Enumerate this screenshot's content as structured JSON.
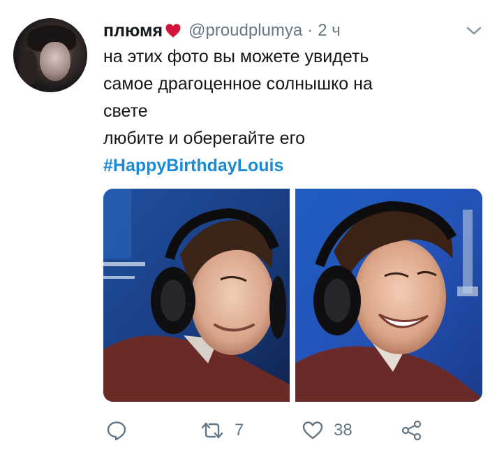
{
  "tweet": {
    "display_name": "плюмя",
    "handle": "@proudplumya",
    "separator": "·",
    "time": "2 ч",
    "lines": [
      "на этих фото вы можете увидеть",
      "самое драгоценное солнышко на",
      "свете",
      "любите и оберегайте его"
    ],
    "hashtag": "#HappyBirthdayLouis"
  },
  "actions": {
    "retweet_count": "7",
    "like_count": "38"
  },
  "icons": {
    "heart_emoji": "heart-icon",
    "caret": "chevron-down-icon",
    "reply": "reply-icon",
    "retweet": "retweet-icon",
    "like": "like-icon",
    "share": "share-icon"
  },
  "colors": {
    "text": "#14171a",
    "muted": "#657786",
    "link": "#1b8ad4",
    "heart": "#e0245e"
  }
}
